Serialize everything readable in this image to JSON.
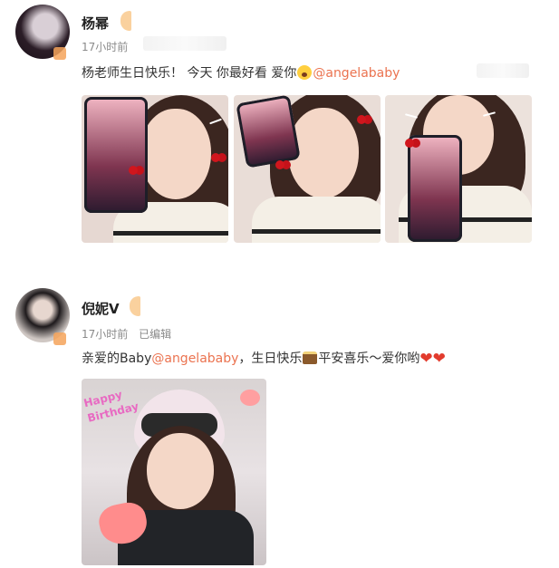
{
  "posts": [
    {
      "username": "杨幂",
      "time": "17小时前",
      "text_parts": [
        "杨老师生日快乐！ 今天 你最好看 爱你",
        "@angelababy"
      ],
      "emoji": [
        "scream-emoji"
      ]
    },
    {
      "username": "倪妮V",
      "time": "17小时前",
      "edited": "已编辑",
      "text_parts": [
        "亲爱的Baby",
        "@angelababy",
        "，生日快乐",
        "平安喜乐～爱你哟"
      ],
      "emoji": [
        "cake-emoji",
        "heart-emoji",
        "heart-emoji"
      ],
      "sticker_text": "Happy Birthday"
    }
  ],
  "colors": {
    "mention": "#eb7350",
    "meta": "#8a8a8a",
    "badge": "#f4a35a"
  }
}
